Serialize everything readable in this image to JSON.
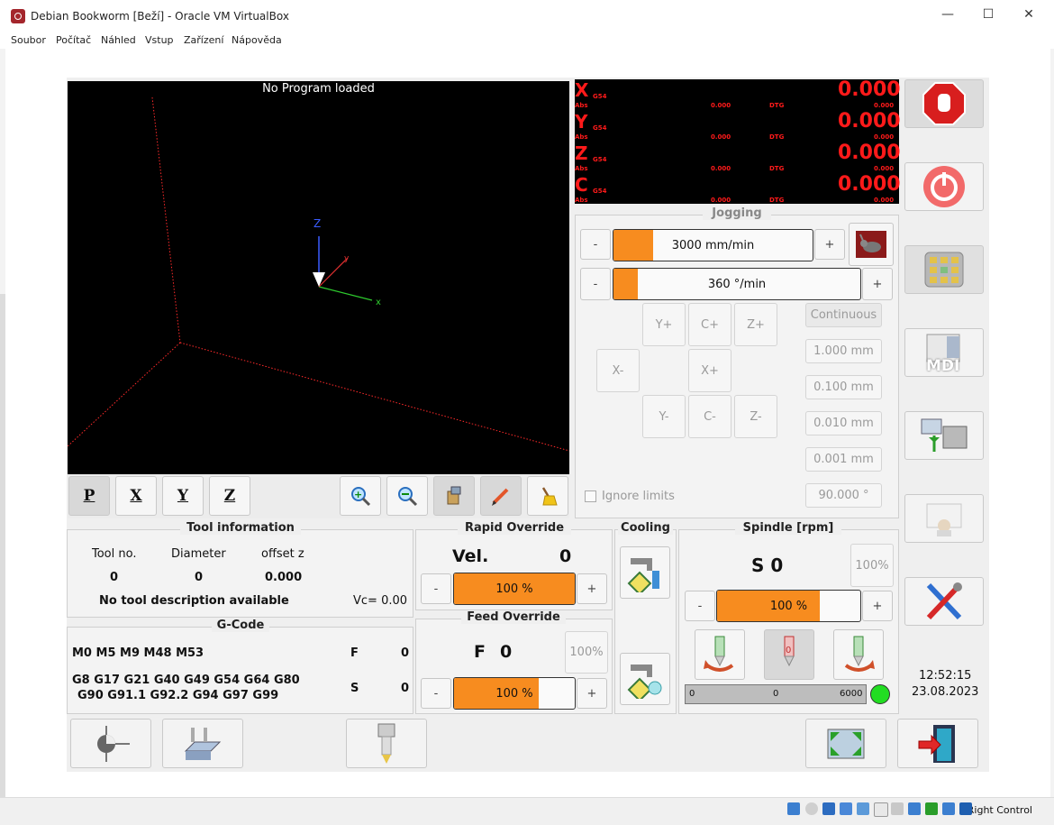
{
  "window": {
    "title": "Debian Bookworm [Beží] - Oracle VM VirtualBox",
    "minimize": "—",
    "maximize": "☐",
    "close": "✕"
  },
  "menu": [
    "Soubor",
    "Počítač",
    "Náhled",
    "Vstup",
    "Zařízení",
    "Nápověda"
  ],
  "preview": {
    "title": "No Program loaded",
    "axis_z": "Z",
    "axis_x": "x",
    "axis_y": "y"
  },
  "view_buttons": {
    "p": "P",
    "x": "X",
    "y": "Y",
    "z": "Z"
  },
  "dro": {
    "rows": [
      {
        "axis": "X",
        "coord": "G54",
        "abs": "Abs",
        "abs_val": "0.000",
        "dtg": "DTG",
        "dtg_val": "0.000",
        "main": "0.000"
      },
      {
        "axis": "Y",
        "coord": "G54",
        "abs": "Abs",
        "abs_val": "0.000",
        "dtg": "DTG",
        "dtg_val": "0.000",
        "main": "0.000"
      },
      {
        "axis": "Z",
        "coord": "G54",
        "abs": "Abs",
        "abs_val": "0.000",
        "dtg": "DTG",
        "dtg_val": "0.000",
        "main": "0.000"
      },
      {
        "axis": "C",
        "coord": "G54",
        "abs": "Abs",
        "abs_val": "0.000",
        "dtg": "DTG",
        "dtg_val": "0.000",
        "main": "0.000"
      }
    ]
  },
  "jogging": {
    "title": "Jogging",
    "linear": {
      "label": "3000 mm/min",
      "fill": 0.2
    },
    "angular": {
      "label": "360 °/min",
      "fill": 0.1
    },
    "minus": "-",
    "plus": "+",
    "axes": {
      "yp": "Y+",
      "cp": "C+",
      "zp": "Z+",
      "xm": "X-",
      "xp": "X+",
      "ym": "Y-",
      "cm": "C-",
      "zm": "Z-"
    },
    "increments": [
      "Continuous",
      "1.000 mm",
      "0.100 mm",
      "0.010 mm",
      "0.001 mm"
    ],
    "angular_increment": "90.000 °",
    "ignore_limits": "Ignore limits"
  },
  "tool": {
    "title": "Tool information",
    "h_no": "Tool no.",
    "h_dia": "Diameter",
    "h_off": "offset z",
    "no": "0",
    "dia": "0",
    "off": "0.000",
    "desc": "No tool description available",
    "vc": "Vc= 0.00"
  },
  "gcode": {
    "title": "G-Code",
    "mcodes": "M0 M5 M9 M48 M53",
    "gcodes_1": "G8 G17 G21 G40 G49 G54 G64 G80",
    "gcodes_2": "G90 G91.1 G92.2 G94 G97 G99",
    "f_label": "F",
    "f_val": "0",
    "s_label": "S",
    "s_val": "0"
  },
  "rapid": {
    "title": "Rapid Override",
    "vel_label": "Vel.",
    "vel_val": "0",
    "bar": "100 %",
    "fill": 1.0
  },
  "feed": {
    "title": "Feed Override",
    "f_label": "F",
    "f_val": "0",
    "pct_btn": "100%",
    "bar": "100 %",
    "fill": 0.7
  },
  "cooling": {
    "title": "Cooling"
  },
  "spindle": {
    "title": "Spindle [rpm]",
    "s_label": "S 0",
    "pct_btn": "100%",
    "bar": "100 %",
    "fill": 0.72,
    "gauge_min": "0",
    "gauge_val": "0",
    "gauge_max": "6000"
  },
  "clock": {
    "time": "12:52:15",
    "date": "23.08.2023"
  },
  "mdi": "MDI",
  "status": {
    "host_key": "Right Control"
  },
  "colors": {
    "orange": "#f78c1f",
    "dro_red": "#ff1a1a",
    "led_green": "#22dd22"
  }
}
